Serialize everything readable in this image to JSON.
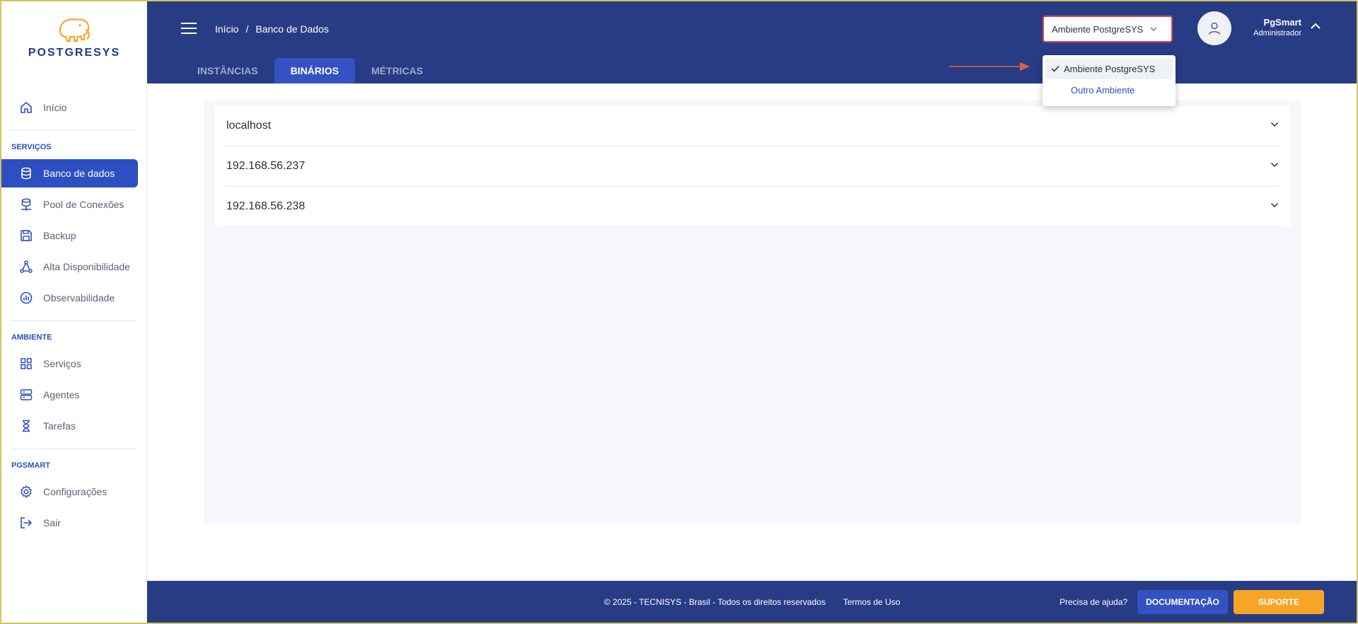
{
  "brand": {
    "logo_text": "POSTGRESYS",
    "accent": "#2d4fc2",
    "logo_color": "#f4a62a"
  },
  "sidebar": {
    "home": "Início",
    "sections": [
      {
        "title": "SERVIÇOS",
        "items": [
          "Banco de dados",
          "Pool de Conexões",
          "Backup",
          "Alta Disponibilidade",
          "Observabilidade"
        ]
      },
      {
        "title": "AMBIENTE",
        "items": [
          "Serviços",
          "Agentes",
          "Tarefas"
        ]
      },
      {
        "title": "PGSMART",
        "items": [
          "Configurações",
          "Sair"
        ]
      }
    ],
    "active_item": "Banco de dados"
  },
  "header": {
    "breadcrumb": [
      "Início",
      "/",
      "Banco de Dados"
    ],
    "tabs": [
      "INSTÂNCIAS",
      "BINÁRIOS",
      "MÉTRICAS"
    ],
    "active_tab": "BINÁRIOS",
    "environment_select": {
      "value": "Ambiente PostgreSYS",
      "options": [
        "Ambiente PostgreSYS",
        "Outro Ambiente"
      ],
      "selected": "Ambiente PostgreSYS"
    },
    "user": {
      "name": "PgSmart",
      "role": "Administrador"
    }
  },
  "main": {
    "hosts": [
      "localhost",
      "192.168.56.237",
      "192.168.56.238"
    ]
  },
  "footer": {
    "copyright": "© 2025 - TECNISYS - Brasil - Todos os direitos reservados",
    "terms": "Termos de Uso",
    "help": "Precisa de ajuda?",
    "doc_button": "DOCUMENTAÇÃO",
    "support_button": "SUPORTE"
  }
}
